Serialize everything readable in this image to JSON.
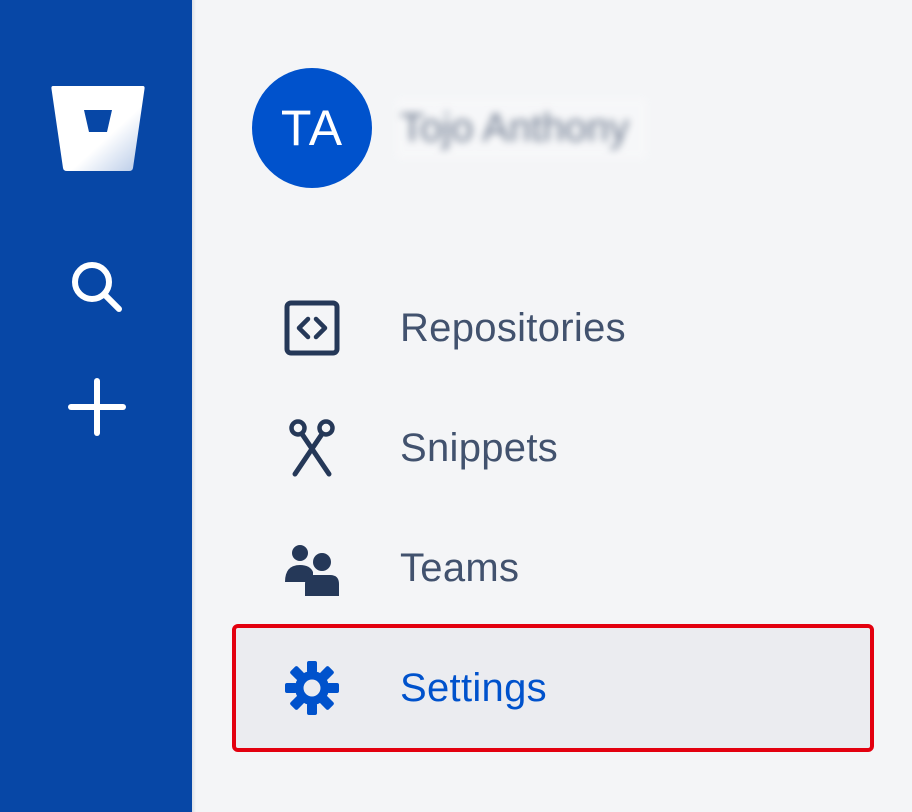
{
  "global_nav": {
    "logo_icon": "bitbucket-logo-icon",
    "search_icon": "search-icon",
    "create_icon": "plus-icon"
  },
  "profile": {
    "initials": "TA",
    "name": "Tojo Anthony",
    "avatar_color": "#0052cc"
  },
  "nav": {
    "items": [
      {
        "label": "Repositories",
        "icon": "code-bracket-icon"
      },
      {
        "label": "Snippets",
        "icon": "scissors-icon"
      },
      {
        "label": "Teams",
        "icon": "people-icon"
      },
      {
        "label": "Settings",
        "icon": "gear-icon",
        "selected": true
      }
    ]
  },
  "colors": {
    "rail": "#0747a6",
    "sidebar": "#f4f5f7",
    "text": "#42526e",
    "accent": "#0052cc",
    "highlight_border": "#e3000f"
  }
}
